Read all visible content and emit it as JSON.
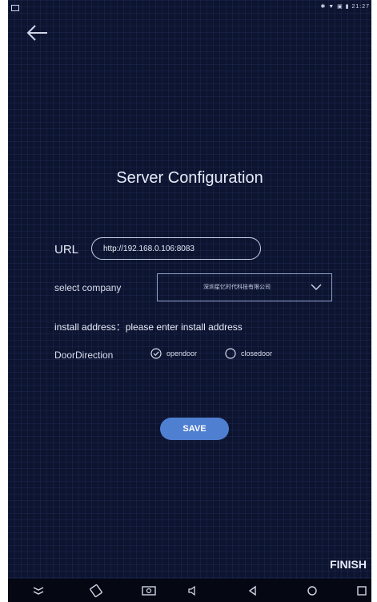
{
  "status_bar": {
    "time_text": "✱ ▼ ▣ ▮ 21:27"
  },
  "header": {
    "back_icon": "arrow-left-icon"
  },
  "page": {
    "title": "Server Configuration"
  },
  "url": {
    "label": "URL",
    "value": "http://192.168.0.106:8083"
  },
  "company": {
    "label": "select company",
    "selected": "深圳星忆时代科技有限公司",
    "icon": "chevron-down-icon"
  },
  "install": {
    "text": "install address：please enter install address"
  },
  "direction": {
    "label": "DoorDirection",
    "options": [
      {
        "label": "opendoor",
        "checked": true,
        "icon": "radio-checked-icon"
      },
      {
        "label": "closedoor",
        "checked": false,
        "icon": "radio-unchecked-icon"
      }
    ]
  },
  "actions": {
    "save_label": "SAVE",
    "finish_label": "FINISH"
  },
  "nav_bar": {
    "icons": [
      "collapse-icon",
      "rotate-icon",
      "screenshot-icon",
      "volume-icon",
      "back-triangle-icon",
      "home-circle-icon",
      "recents-square-icon"
    ]
  },
  "colors": {
    "background": "#0d1430",
    "accent": "#4f7fd1",
    "text": "#e6ebf7"
  }
}
